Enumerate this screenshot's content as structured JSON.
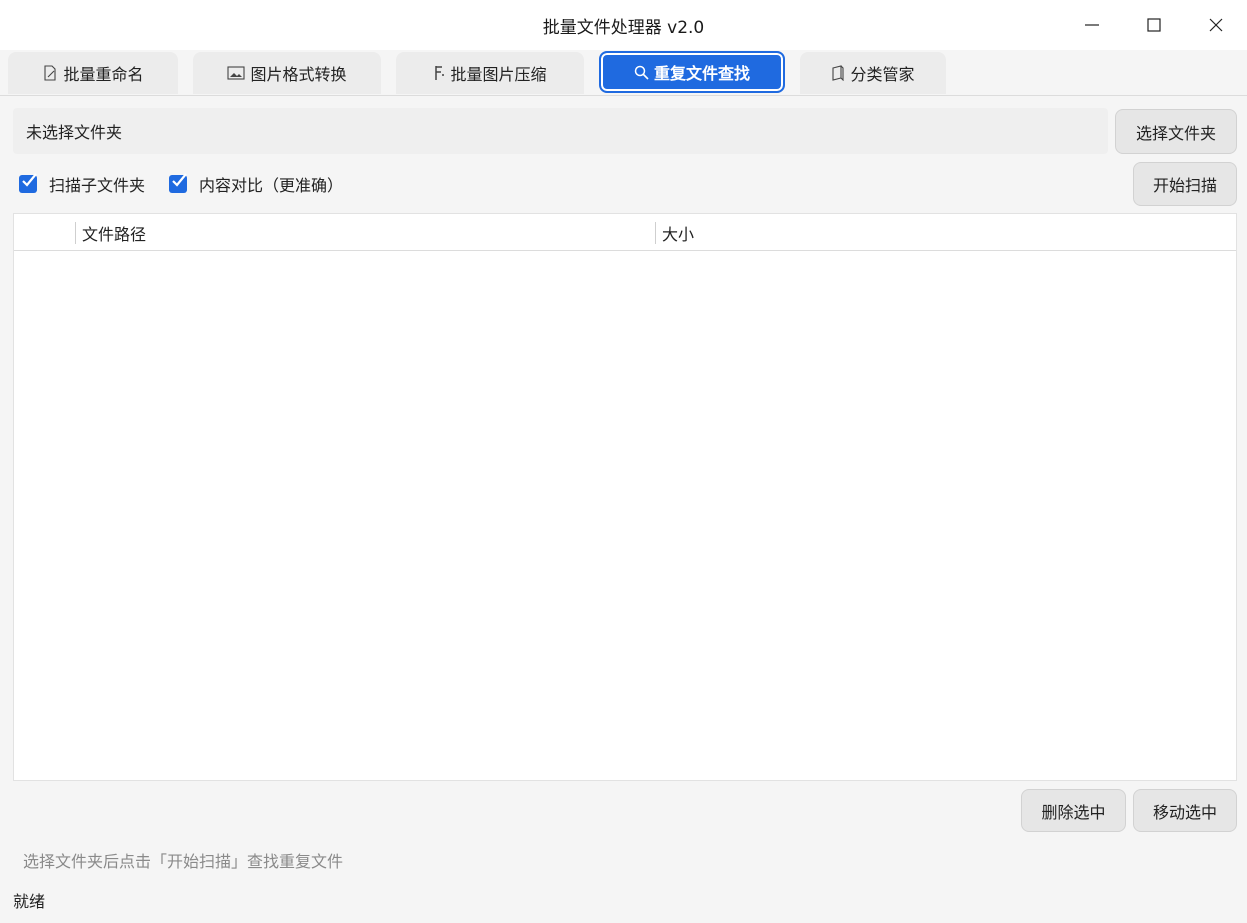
{
  "window": {
    "title": "批量文件处理器 v2.0"
  },
  "tabs": [
    {
      "label": "批量重命名",
      "icon": "document-edit-icon"
    },
    {
      "label": "图片格式转换",
      "icon": "picture-icon"
    },
    {
      "label": "批量图片压缩",
      "icon": "compress-icon"
    },
    {
      "label": "重复文件查找",
      "icon": "search-icon",
      "active": true
    },
    {
      "label": "分类管家",
      "icon": "folder-book-icon"
    }
  ],
  "folder": {
    "path_text": "未选择文件夹",
    "select_button": "选择文件夹"
  },
  "options": {
    "scan_subfolders": {
      "label": "扫描子文件夹",
      "checked": true
    },
    "content_compare": {
      "label": "内容对比（更准确）",
      "checked": true
    },
    "start_button": "开始扫描"
  },
  "table": {
    "columns": [
      "文件路径",
      "大小"
    ],
    "rows": []
  },
  "actions": {
    "delete_button": "删除选中",
    "move_button": "移动选中"
  },
  "hint": "选择文件夹后点击「开始扫描」查找重复文件",
  "status": "就绪",
  "colors": {
    "accent": "#1f6ae0",
    "background": "#f5f5f5"
  }
}
